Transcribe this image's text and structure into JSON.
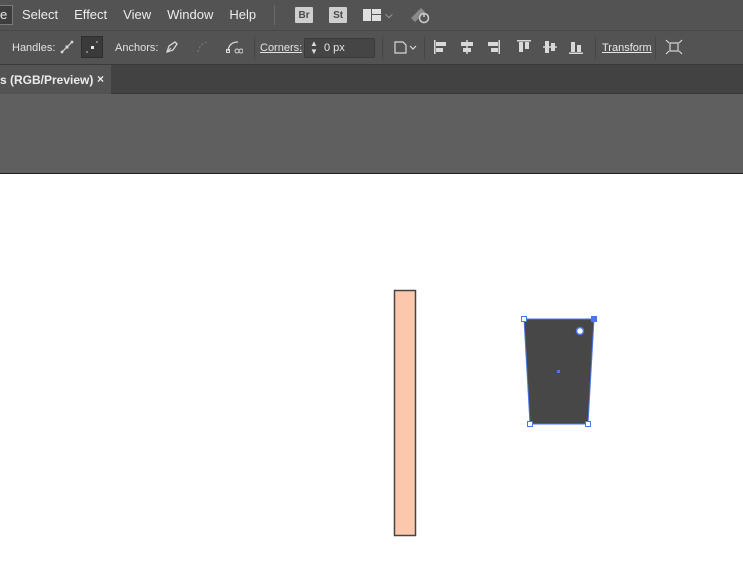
{
  "menubar": {
    "partial_item": "e",
    "items": [
      "Select",
      "Effect",
      "View",
      "Window",
      "Help"
    ],
    "bridge_badge": "Br",
    "stock_badge": "St",
    "workspace_icon": "workspace-layout-icon",
    "gpu_icon": "gpu-performance-icon"
  },
  "controlbar": {
    "handles_label": "Handles:",
    "anchors_label": "Anchors:",
    "corners_label": "Corners:",
    "corners_value": "0 px",
    "transform_label": "Transform"
  },
  "document": {
    "tab_title": "s (RGB/Preview)",
    "close_glyph": "×"
  },
  "colors": {
    "ui_dark": "#535353",
    "pasteboard": "#5f5f5f",
    "rect_fill": "#fcc8ad",
    "rect_stroke": "#444444",
    "shape_fill": "#474747",
    "selection": "#4a76e8"
  }
}
